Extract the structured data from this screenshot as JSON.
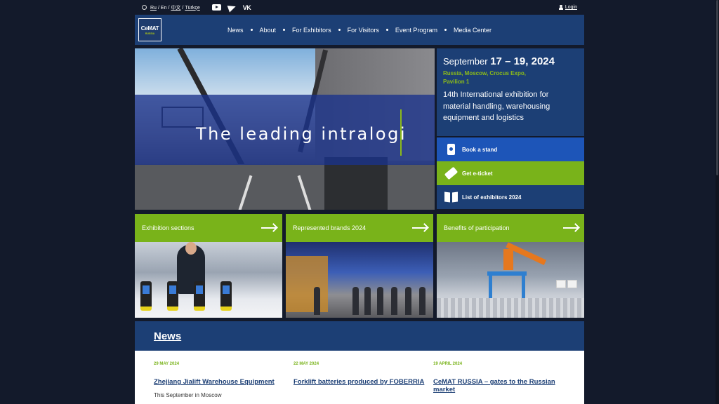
{
  "topbar": {
    "languages": [
      "Ru",
      "En",
      "中文",
      "Türkçe"
    ],
    "social": [
      "youtube-icon",
      "telegram-icon",
      "vk-icon"
    ],
    "vk_label": "VK",
    "login": "Login"
  },
  "nav": {
    "logo_name": "CeMAT",
    "logo_sub": "RUSSIA",
    "items": [
      "News",
      "About",
      "For Exhibitors",
      "For Visitors",
      "Event Program",
      "Media Center"
    ]
  },
  "hero": {
    "headline": "The leading intralogi"
  },
  "info": {
    "date_month": "September",
    "date_range": "17 – 19, 2024",
    "location_line1": "Russia, Moscow, Crocus Expo,",
    "location_line2": "Pavilion 1",
    "description": "14th International exhibition for material handling, warehousing equipment and logistics"
  },
  "actions": [
    {
      "label": "Book a stand",
      "icon": "badge-icon",
      "color": "#1d55b8"
    },
    {
      "label": "Get e-ticket",
      "icon": "ticket-icon",
      "color": "#79b31a"
    },
    {
      "label": "List of exhibitors 2024",
      "icon": "book-icon",
      "color": "#1c3f75"
    }
  ],
  "cards": [
    {
      "label": "Exhibition sections"
    },
    {
      "label": "Represented brands 2024"
    },
    {
      "label": "Benefits of participation"
    }
  ],
  "news": {
    "title": "News",
    "items": [
      {
        "date": "29 MAY 2024",
        "headline": "Zhejiang Jialift Warehouse Equipment",
        "excerpt": "This September in Moscow"
      },
      {
        "date": "22 MAY 2024",
        "headline": "Forklift batteries produced by FOBERRIA",
        "excerpt": ""
      },
      {
        "date": "19 APRIL 2024",
        "headline": "CeMAT RUSSIA – gates to the Russian market",
        "excerpt": ""
      }
    ]
  },
  "colors": {
    "navy": "#1c3f75",
    "green": "#79b31a",
    "blue": "#1d55b8",
    "background": "#131a2b"
  }
}
